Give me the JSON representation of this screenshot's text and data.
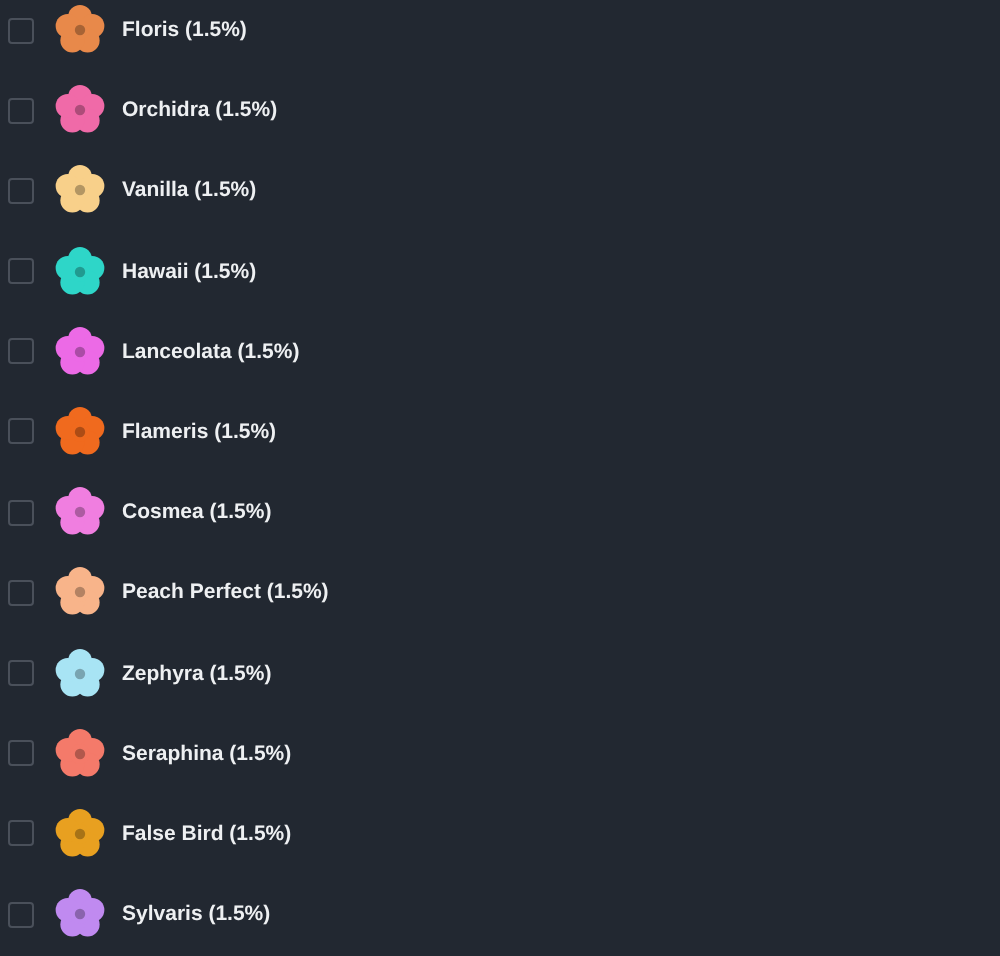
{
  "items": [
    {
      "label": "Floris (1.5%)",
      "checked": false,
      "color": "#e8894a"
    },
    {
      "label": "Orchidra (1.5%)",
      "checked": false,
      "color": "#f06aa8"
    },
    {
      "label": "Vanilla (1.5%)",
      "checked": false,
      "color": "#f8d08a"
    },
    {
      "label": "Hawaii (1.5%)",
      "checked": false,
      "color": "#2ed6c8"
    },
    {
      "label": "Lanceolata (1.5%)",
      "checked": false,
      "color": "#ec6ae6"
    },
    {
      "label": "Flameris (1.5%)",
      "checked": false,
      "color": "#f06a1e"
    },
    {
      "label": "Cosmea (1.5%)",
      "checked": false,
      "color": "#f07ee0"
    },
    {
      "label": "Peach Perfect (1.5%)",
      "checked": false,
      "color": "#f8b48a"
    },
    {
      "label": "Zephyra (1.5%)",
      "checked": false,
      "color": "#a8e4f4"
    },
    {
      "label": "Seraphina (1.5%)",
      "checked": false,
      "color": "#f47a6a"
    },
    {
      "label": "False Bird (1.5%)",
      "checked": false,
      "color": "#e8a020"
    },
    {
      "label": "Sylvaris (1.5%)",
      "checked": false,
      "color": "#c08af0"
    }
  ]
}
